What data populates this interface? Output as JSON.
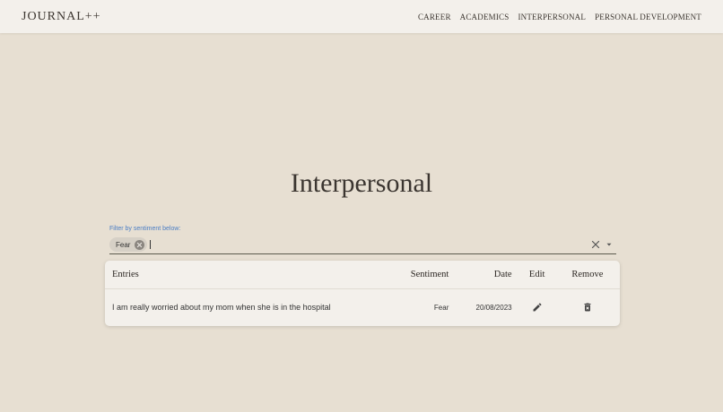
{
  "navbar": {
    "brand": "JOURNAL++",
    "links": [
      "CAREER",
      "ACADEMICS",
      "INTERPERSONAL",
      "PERSONAL DEVELOPMENT"
    ]
  },
  "page": {
    "title": "Interpersonal"
  },
  "filter": {
    "label": "Filter by sentiment below:",
    "selected_chips": [
      "Fear"
    ],
    "icons": {
      "chip_remove": "cancel-circle-icon",
      "clear": "close-icon",
      "dropdown": "arrow-drop-down-icon"
    }
  },
  "table": {
    "headers": {
      "entries": "Entries",
      "sentiment": "Sentiment",
      "date": "Date",
      "edit": "Edit",
      "remove": "Remove"
    },
    "rows": [
      {
        "entry": "I am really worried about my mom when she is in the hospital",
        "sentiment": "Fear",
        "date": "20/08/2023",
        "edit_icon": "pencil-icon",
        "remove_icon": "trash-icon"
      }
    ]
  },
  "colors": {
    "background": "#e7dfd2",
    "navbar": "#f3f0eb",
    "label_accent": "#4a7dc4",
    "text_dark": "#3b3530"
  }
}
